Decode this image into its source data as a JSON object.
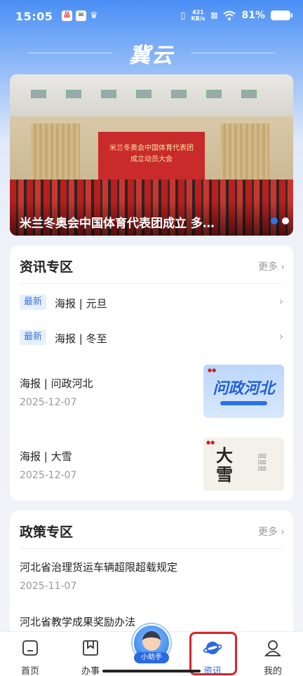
{
  "status_bar": {
    "time": "15:05",
    "speed_value": "421",
    "speed_unit": "KB/s",
    "battery": "81%"
  },
  "logo_text": "冀云",
  "banner": {
    "caption": "米兰冬奥会中国体育代表团成立 多…",
    "stage_line1": "米兰冬奥会中国体育代表团",
    "stage_line2": "成立动员大会",
    "active_dot_color": "#2f76e6"
  },
  "news_section": {
    "title": "资讯专区",
    "more": "更多",
    "tag_rows": [
      {
        "tag": "最新",
        "text": "海报 | 元旦"
      },
      {
        "tag": "最新",
        "text": "海报 | 冬至"
      }
    ],
    "items": [
      {
        "title": "海报 | 问政河北",
        "date": "2025-12-07",
        "thumb_text": "问政河北"
      },
      {
        "title": "海报 | 大雪",
        "date": "2025-12-07",
        "thumb_text": "大雪"
      }
    ]
  },
  "policy_section": {
    "title": "政策专区",
    "more": "更多",
    "items": [
      {
        "title": "河北省治理货运车辆超限超载规定",
        "date": "2025-11-07"
      },
      {
        "title": "河北省教学成果奖励办法"
      }
    ]
  },
  "bottom_nav": {
    "items": [
      {
        "label": "首页",
        "icon": "home-icon"
      },
      {
        "label": "办事",
        "icon": "bookmark-icon"
      },
      {
        "label": "资讯",
        "icon": "planet-icon",
        "active": true
      },
      {
        "label": "我的",
        "icon": "user-icon"
      }
    ],
    "assistant_label": "小助手",
    "active_color": "#2a6ae0",
    "highlight_color": "#d9262c"
  }
}
